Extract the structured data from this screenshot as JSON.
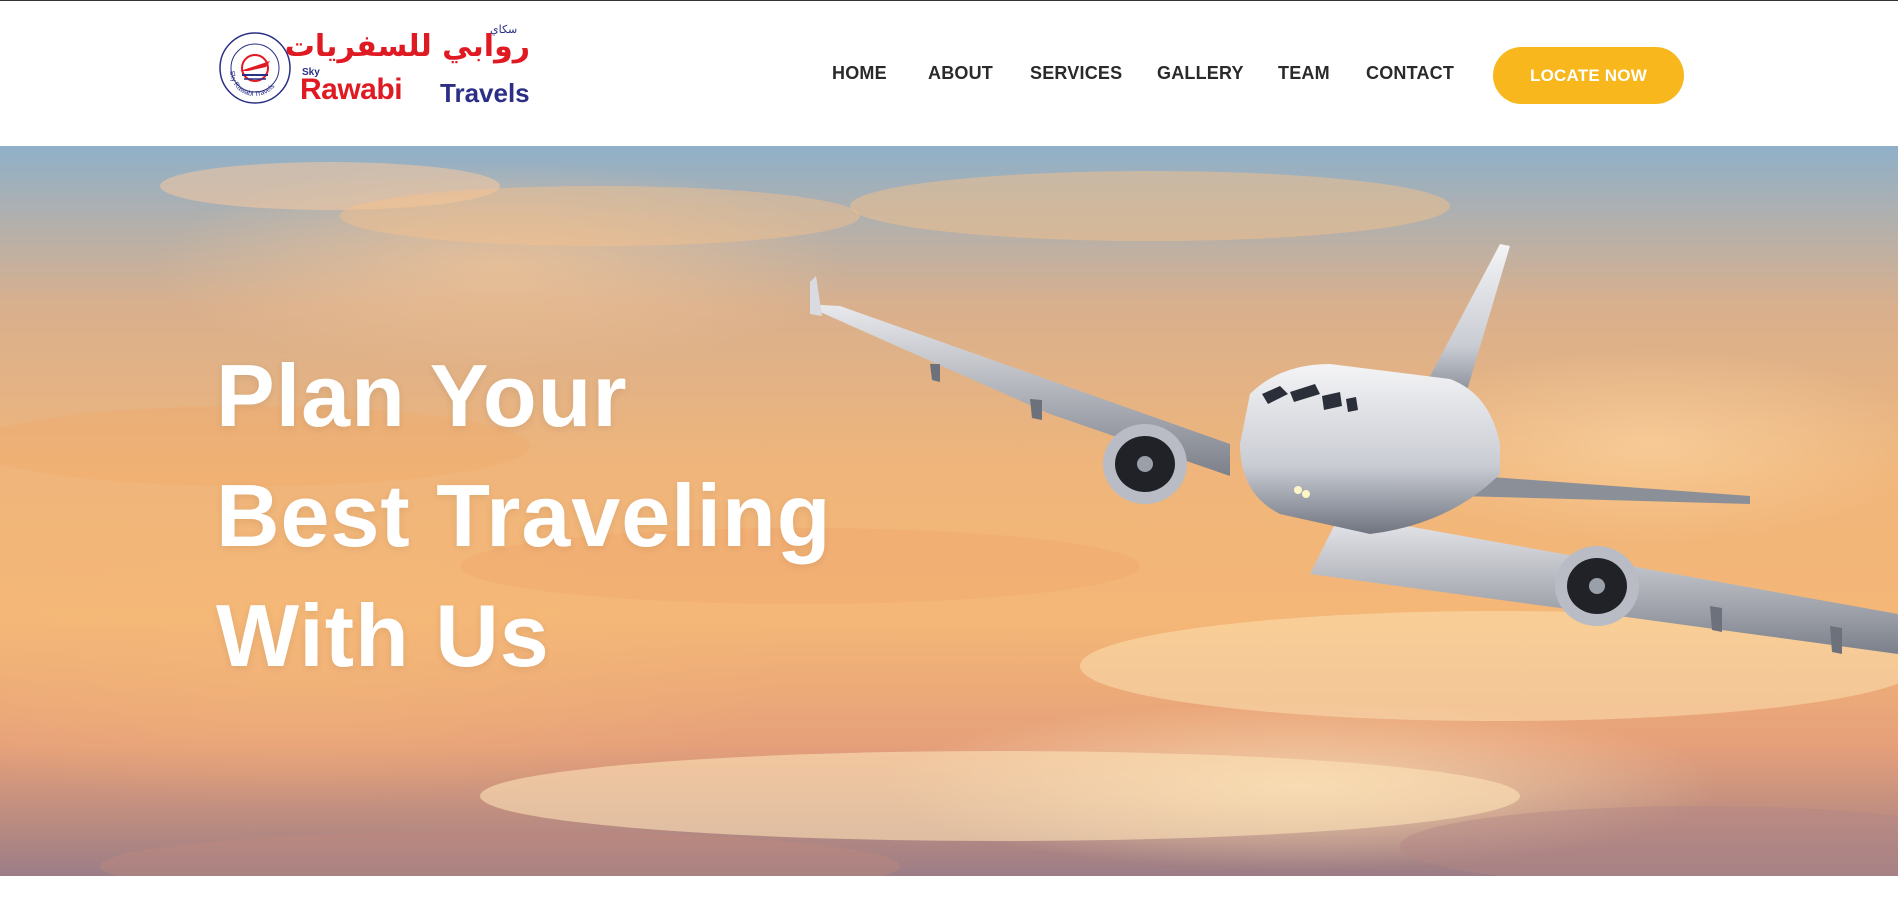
{
  "brand": {
    "arabic_name": "روابي للسفريات",
    "arabic_sky": "سكاي",
    "sky": "Sky",
    "name_primary": "Rawabi",
    "name_secondary": "Travels",
    "seal_text": "Sky Rawabi Travels",
    "colors": {
      "red": "#e01a22",
      "blue": "#2b2f85"
    }
  },
  "nav": {
    "items": [
      {
        "label": "HOME"
      },
      {
        "label": "ABOUT"
      },
      {
        "label": "SERVICES"
      },
      {
        "label": "GALLERY"
      },
      {
        "label": "TEAM"
      },
      {
        "label": "CONTACT"
      }
    ],
    "cta_label": "LOCATE NOW",
    "cta_color": "#f7b71d"
  },
  "hero": {
    "title_lines": [
      "Plan Your",
      "Best Traveling",
      "With Us"
    ],
    "image_icon": "airplane-in-sunset-sky"
  }
}
